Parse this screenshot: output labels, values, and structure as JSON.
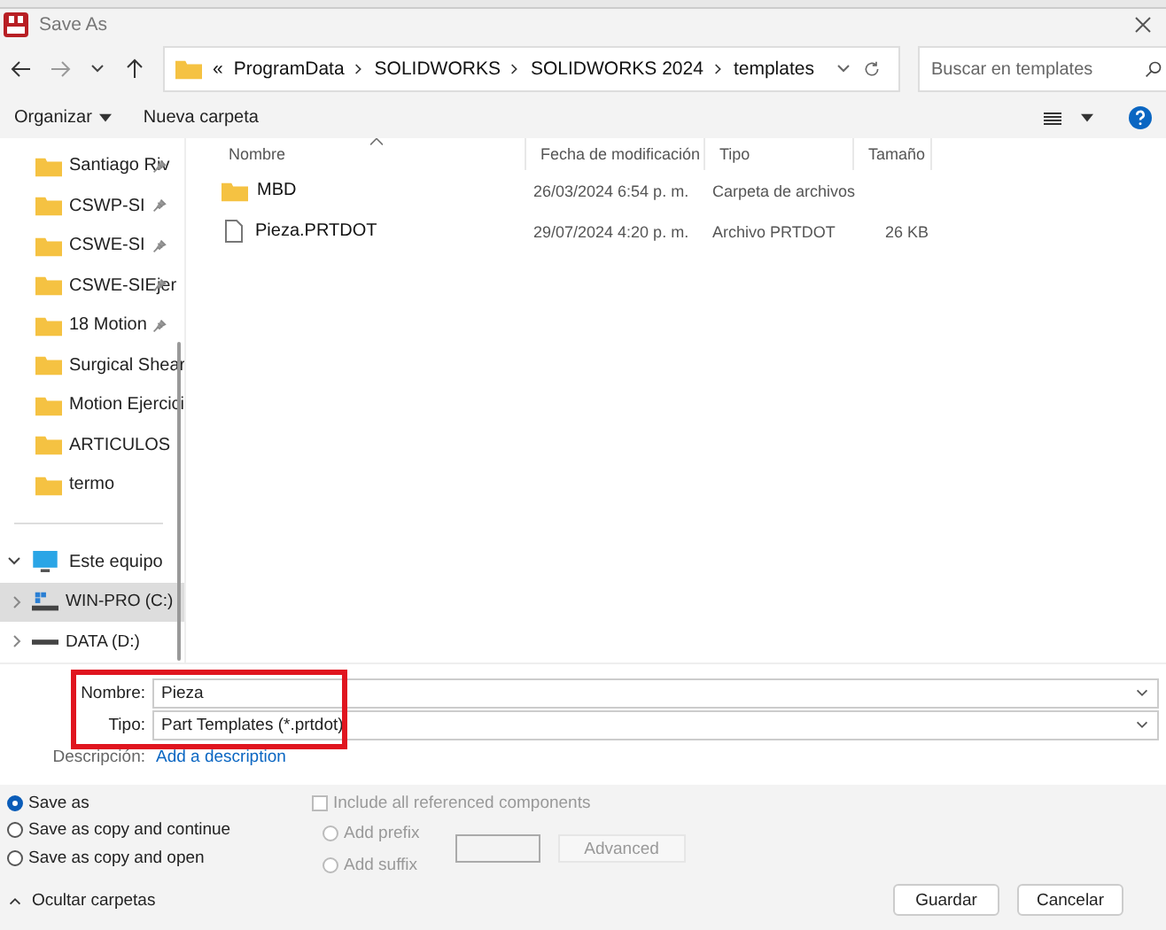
{
  "window": {
    "title": "Save As"
  },
  "address": {
    "overflow": "«",
    "crumbs": [
      "ProgramData",
      "SOLIDWORKS",
      "SOLIDWORKS 2024",
      "templates"
    ]
  },
  "search": {
    "placeholder": "Buscar en templates"
  },
  "toolbar": {
    "organize": "Organizar",
    "new_folder": "Nueva carpeta"
  },
  "sidebar": {
    "items": [
      {
        "label": "Santiago Riv",
        "kind": "folder",
        "pinned": true,
        "selected": false
      },
      {
        "label": "CSWP-SI",
        "kind": "folder",
        "pinned": true,
        "selected": false
      },
      {
        "label": "CSWE-SI",
        "kind": "folder",
        "pinned": true,
        "selected": false
      },
      {
        "label": "CSWE-SIEjer",
        "kind": "folder",
        "pinned": true,
        "selected": false
      },
      {
        "label": "18 Motion",
        "kind": "folder",
        "pinned": true,
        "selected": false
      },
      {
        "label": "Surgical Shear",
        "kind": "folder",
        "pinned": false,
        "selected": false
      },
      {
        "label": "Motion Ejercici",
        "kind": "folder",
        "pinned": false,
        "selected": false
      },
      {
        "label": "ARTICULOS",
        "kind": "folder",
        "pinned": false,
        "selected": false
      },
      {
        "label": "termo",
        "kind": "folder",
        "pinned": false,
        "selected": false
      }
    ],
    "tree": [
      {
        "label": "Este equipo",
        "kind": "computer",
        "expanded": true,
        "selected": false,
        "children": [
          {
            "label": "WIN-PRO (C:)",
            "kind": "system-drive",
            "expanded": false,
            "selected": true
          },
          {
            "label": "DATA (D:)",
            "kind": "drive",
            "expanded": false,
            "selected": false
          }
        ]
      }
    ]
  },
  "table": {
    "columns": [
      "Nombre",
      "Fecha de modificación",
      "Tipo",
      "Tamaño"
    ],
    "rows": [
      {
        "kind": "folder",
        "cells": [
          "MBD",
          "26/03/2024 6:54 p. m.",
          "Carpeta de archivos",
          ""
        ]
      },
      {
        "kind": "file",
        "cells": [
          "Pieza.PRTDOT",
          "29/07/2024 4:20 p. m.",
          "Archivo PRTDOT",
          "26 KB"
        ]
      }
    ]
  },
  "form": {
    "name_label": "Nombre:",
    "name_value": "Pieza",
    "type_label": "Tipo:",
    "type_value": "Part Templates (*.prtdot)",
    "description_label": "Descripción:",
    "description_link": "Add a description"
  },
  "save_options": [
    {
      "label": "Save as",
      "selected": true
    },
    {
      "label": "Save as copy and continue",
      "selected": false
    },
    {
      "label": "Save as copy and open",
      "selected": false
    }
  ],
  "references": {
    "include_label": "Include all referenced components",
    "checked": false,
    "disabled": true,
    "options": [
      {
        "label": "Add prefix",
        "selected": false
      },
      {
        "label": "Add suffix",
        "selected": false
      }
    ],
    "advanced": "Advanced"
  },
  "footer": {
    "hide_folders": "Ocultar carpetas",
    "save": "Guardar",
    "cancel": "Cancelar"
  }
}
